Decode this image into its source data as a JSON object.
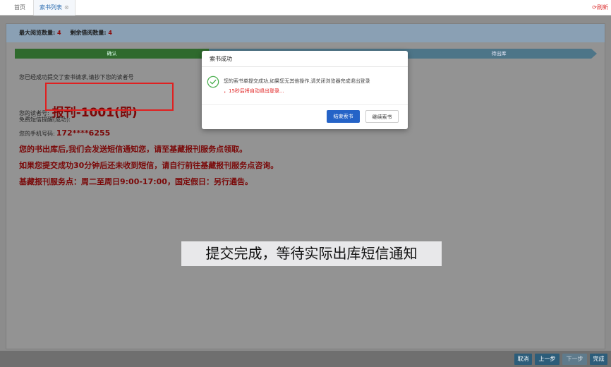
{
  "tabs": {
    "home": "首页",
    "active": "索书列表",
    "close_glyph": "⊗",
    "refresh_label": "刷新"
  },
  "stats": {
    "max_label": "最大阅览数量:",
    "max_value": "4",
    "remain_label": "剩余借阅数量:",
    "remain_value": "4"
  },
  "steps": [
    "确认",
    "",
    "待出库"
  ],
  "content": {
    "submitted": "您已经成功提交了索书请求,请抄下您的读者号",
    "reader_label": "您的读者号:",
    "reader_number": "报刊-1001(即)",
    "sms_label": "免费短信提醒(成功):",
    "phone_label": "您的手机号码:",
    "phone_value": "172****6255",
    "notice1": "您的书出库后,我们会发送短信通知您，请至基藏报刊服务点领取。",
    "notice2": "如果您提交成功30分钟后还未收到短信，请自行前往基藏报刊服务点咨询。",
    "notice3": "基藏报刊服务点：周二至周日9:00-17:00，国定假日：另行通告。"
  },
  "caption": "提交完成，等待实际出库短信通知",
  "bottom_buttons": {
    "cancel": "取消",
    "prev": "上一步",
    "next": "下一步",
    "done": "完成"
  },
  "modal": {
    "title": "索书成功",
    "message": "您的索书单提交成功,如果您无其他操作,请关闭浏览器完成退出登录",
    "countdown": "，15秒后将自动退出登录...",
    "end_button": "结束索书",
    "continue_button": "继续索书"
  },
  "colors": {
    "accent_blue": "#2563c7",
    "alert_red": "#e02020",
    "step_done_green": "#2f6a2d",
    "success_green": "#4caf50"
  }
}
